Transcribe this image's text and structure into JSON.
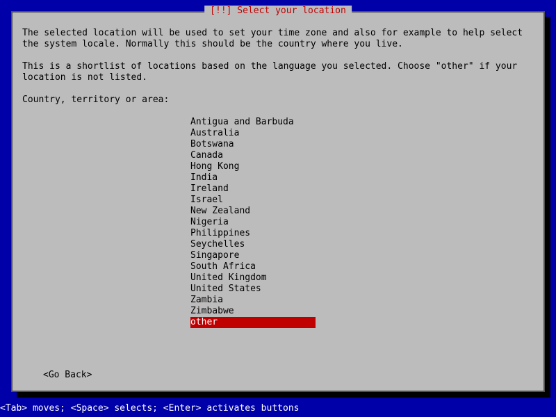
{
  "dialog": {
    "title": "[!!] Select your location",
    "description1": "The selected location will be used to set your time zone and also for example to help select the system locale. Normally this should be the country where you live.",
    "description2": "This is a shortlist of locations based on the language you selected. Choose \"other\" if your location is not listed.",
    "prompt": "Country, territory or area:",
    "items": [
      "Antigua and Barbuda",
      "Australia",
      "Botswana",
      "Canada",
      "Hong Kong",
      "India",
      "Ireland",
      "Israel",
      "New Zealand",
      "Nigeria",
      "Philippines",
      "Seychelles",
      "Singapore",
      "South Africa",
      "United Kingdom",
      "United States",
      "Zambia",
      "Zimbabwe",
      "other"
    ],
    "selectedIndex": 18,
    "goBack": "Go Back"
  },
  "footer": "<Tab> moves; <Space> selects; <Enter> activates buttons"
}
